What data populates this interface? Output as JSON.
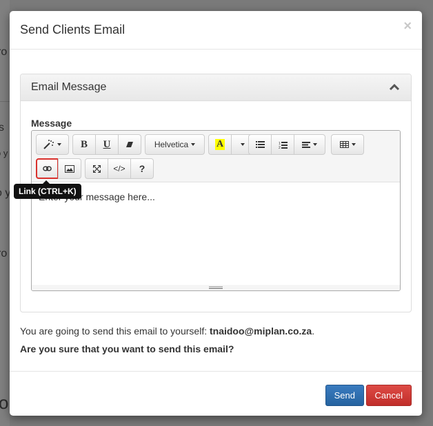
{
  "background": {
    "fragments": [
      "ro",
      "s",
      "o y",
      "o y",
      "ro",
      "o"
    ]
  },
  "modal": {
    "title": "Send Clients Email",
    "close_label": "×",
    "panel": {
      "title": "Email Message",
      "collapse_icon": "chevron-up-icon",
      "field_label": "Message",
      "editor": {
        "toolbar": {
          "style_icon": "magic-wand-icon",
          "bold": "B",
          "underline": "U",
          "eraser_icon": "eraser-icon",
          "font_name": "Helvetica",
          "color_letter": "A",
          "highlight_color": "#ffff00",
          "unordered_list_icon": "unordered-list-icon",
          "ordered_list_icon": "ordered-list-icon",
          "align_icon": "align-icon",
          "table_icon": "table-icon",
          "link_icon": "link-icon",
          "picture_icon": "picture-icon",
          "fullscreen_icon": "fullscreen-icon",
          "codeview": "</>",
          "help": "?"
        },
        "placeholder": "Enter your message here...",
        "tooltip": "Link (CTRL+K)"
      }
    },
    "info": {
      "prefix": "You are going to send this email to yourself: ",
      "email": "tnaidoo@miplan.co.za",
      "suffix": "."
    },
    "confirm": "Are you sure that you want to send this email?",
    "footer": {
      "send_label": "Send",
      "cancel_label": "Cancel"
    }
  },
  "colors": {
    "send": "#2d6ca8",
    "cancel": "#d0363a",
    "active_outline": "#d9302c"
  }
}
